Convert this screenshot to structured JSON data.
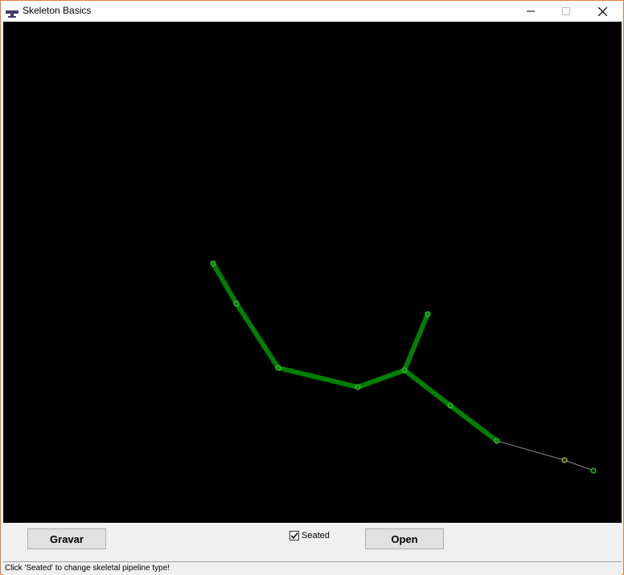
{
  "window": {
    "title": "Skeleton Basics",
    "icon": "kinect-sensor-icon",
    "controls": [
      "minimize",
      "maximize",
      "close"
    ]
  },
  "colors": {
    "canvas_bg": "#000000",
    "bone_tracked": "#008000",
    "bone_inferred": "#808080",
    "joint_tracked": "#44d444",
    "joint_inferred": "#d4d444"
  },
  "toolbar": {
    "record_label": "Gravar",
    "open_label": "Open",
    "seated_label": "Seated",
    "seated_checked": true
  },
  "status": {
    "text": "Click 'Seated' to change skeletal pipeline type!"
  }
}
